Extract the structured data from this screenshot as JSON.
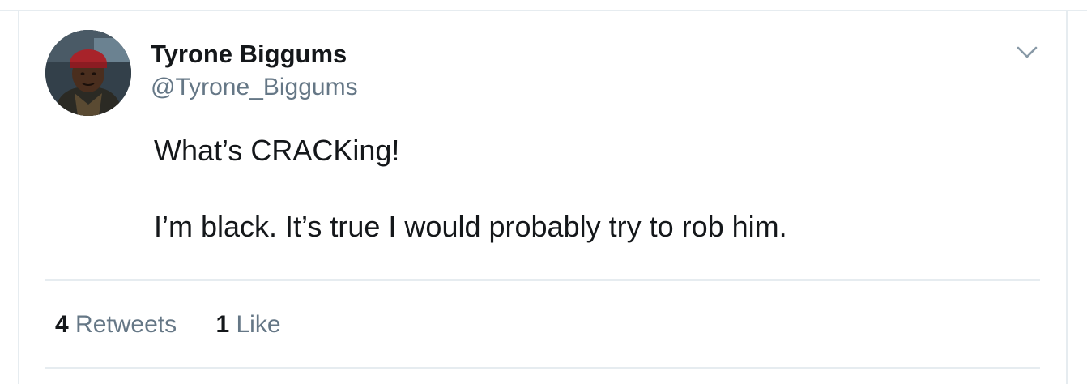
{
  "tweet": {
    "author": {
      "display_name": "Tyrone Biggums",
      "handle": "@Tyrone_Biggums",
      "avatar_icon": "profile-photo"
    },
    "text_lines": [
      "What’s CRACKing!",
      "I’m black. It’s true I would probably try to rob him."
    ],
    "stats": {
      "retweets": {
        "count": "4",
        "label": "Retweets"
      },
      "likes": {
        "count": "1",
        "label": "Like"
      }
    },
    "more_menu_icon": "chevron-down-icon"
  },
  "colors": {
    "primary_text": "#14171a",
    "secondary_text": "#657786",
    "divider": "#e6ecf0",
    "background": "#ffffff"
  }
}
